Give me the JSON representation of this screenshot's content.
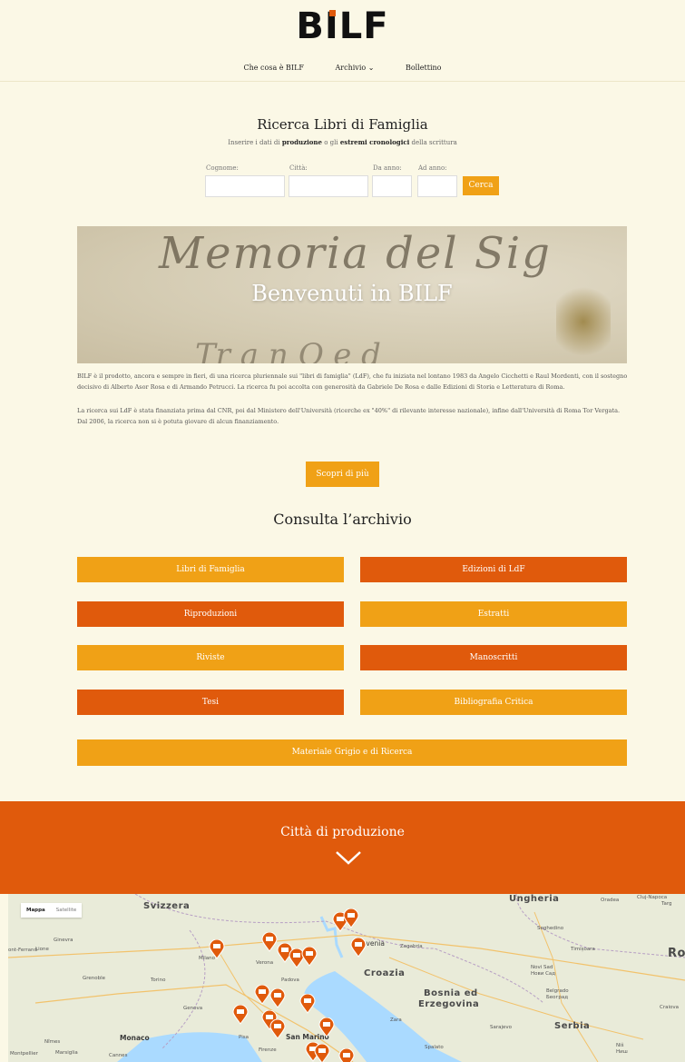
{
  "header": {
    "logo": "BILF",
    "nav": {
      "about": "Che cosa è BILF",
      "archive": "Archivio ⌄",
      "bulletin": "Bollettino"
    }
  },
  "search": {
    "title": "Ricerca Libri di Famiglia",
    "subtitle_pre": "Inserire i dati di ",
    "subtitle_b1": "produzione",
    "subtitle_mid": " o gli ",
    "subtitle_b2": "estremi cronologici",
    "subtitle_post": " della scrittura",
    "fields": {
      "cognome": "Cognome:",
      "citta": "Città:",
      "da_anno": "Da anno:",
      "ad_anno": "Ad anno:"
    },
    "button": "Cerca"
  },
  "banner": {
    "script_line1": "Memoria del Sig",
    "script_line2": "Tr a n Q e d",
    "welcome": "Benvenuti in BILF"
  },
  "intro": {
    "p1": "BILF è il prodotto, ancora e sempre in fieri, di una ricerca pluriennale sui \"libri di famiglia\" (LdF), che fu iniziata nel lontano 1983 da Angelo Cicchetti e Raul Mordenti, con il sostegno decisivo di Alberto Asor Rosa e di Armando Petrucci. La ricerca fu poi accolta con generosità da Gabriele De Rosa e dalle Edizioni di Storia e Letteratura di Roma.",
    "p2": "La ricerca sui LdF è stata finanziata prima dal CNR, poi dal Ministero dell'Università (ricerche ex \"40%\" di rilevante interesse nazionale), infine dall'Università di Roma Tor Vergata. Dal 2006, la ricerca non si è potuta giovare di alcun finanziamento.",
    "more_button": "Scopri di più"
  },
  "archive": {
    "title": "Consulta l’archivio",
    "buttons": {
      "libri": "Libri di Famiglia",
      "edizioni": "Edizioni di LdF",
      "riproduzioni": "Riproduzioni",
      "estratti": "Estratti",
      "riviste": "Riviste",
      "manoscritti": "Manoscritti",
      "tesi": "Tesi",
      "bibliografia": "Bibliografia Critica",
      "materiale": "Materiale Grigio e di Ricerca"
    }
  },
  "cities": {
    "title": "Città di produzione"
  },
  "map": {
    "tab_map": "Mappa",
    "tab_satellite": "Satellite",
    "labels": {
      "svizzera": "Svizzera",
      "ungheria": "Ungheria",
      "croazia": "Croazia",
      "bosnia1": "Bosnia ed",
      "bosnia2": "Erzegovina",
      "serbia": "Serbia",
      "slovenia": "Slovenia",
      "ro": "Ro",
      "monaco": "Monaco",
      "san_marino": "San Marino",
      "ginevra": "Ginevra",
      "lione": "Lione",
      "ferrand": "ont-Ferrand",
      "grenoble": "Grenoble",
      "torino": "Torino",
      "milano": "Milano",
      "verona": "Verona",
      "padova": "Padova",
      "genova": "Genova",
      "nimes": "Nîmes",
      "montpellier": "Montpellier",
      "marsiglia": "Marsiglia",
      "cannes": "Cannes",
      "pisa": "Pisa",
      "firenze": "Firenze",
      "zara": "Zara",
      "spalato": "Spalato",
      "sarajevo": "Sarajevo",
      "zagabria": "Zagabria",
      "seghedino": "Seghedino",
      "timisoara": "Timișoara",
      "novi_sad1": "Novi Sad",
      "novi_sad2": "Нови Сад",
      "belgrado1": "Belgrado",
      "belgrado2": "Београд",
      "craiova": "Craiova",
      "nis1": "Niš",
      "nis2": "Ниш",
      "oradea": "Oradea",
      "cluj1": "Cluj-Napoca",
      "cluj2": "Targ"
    }
  }
}
